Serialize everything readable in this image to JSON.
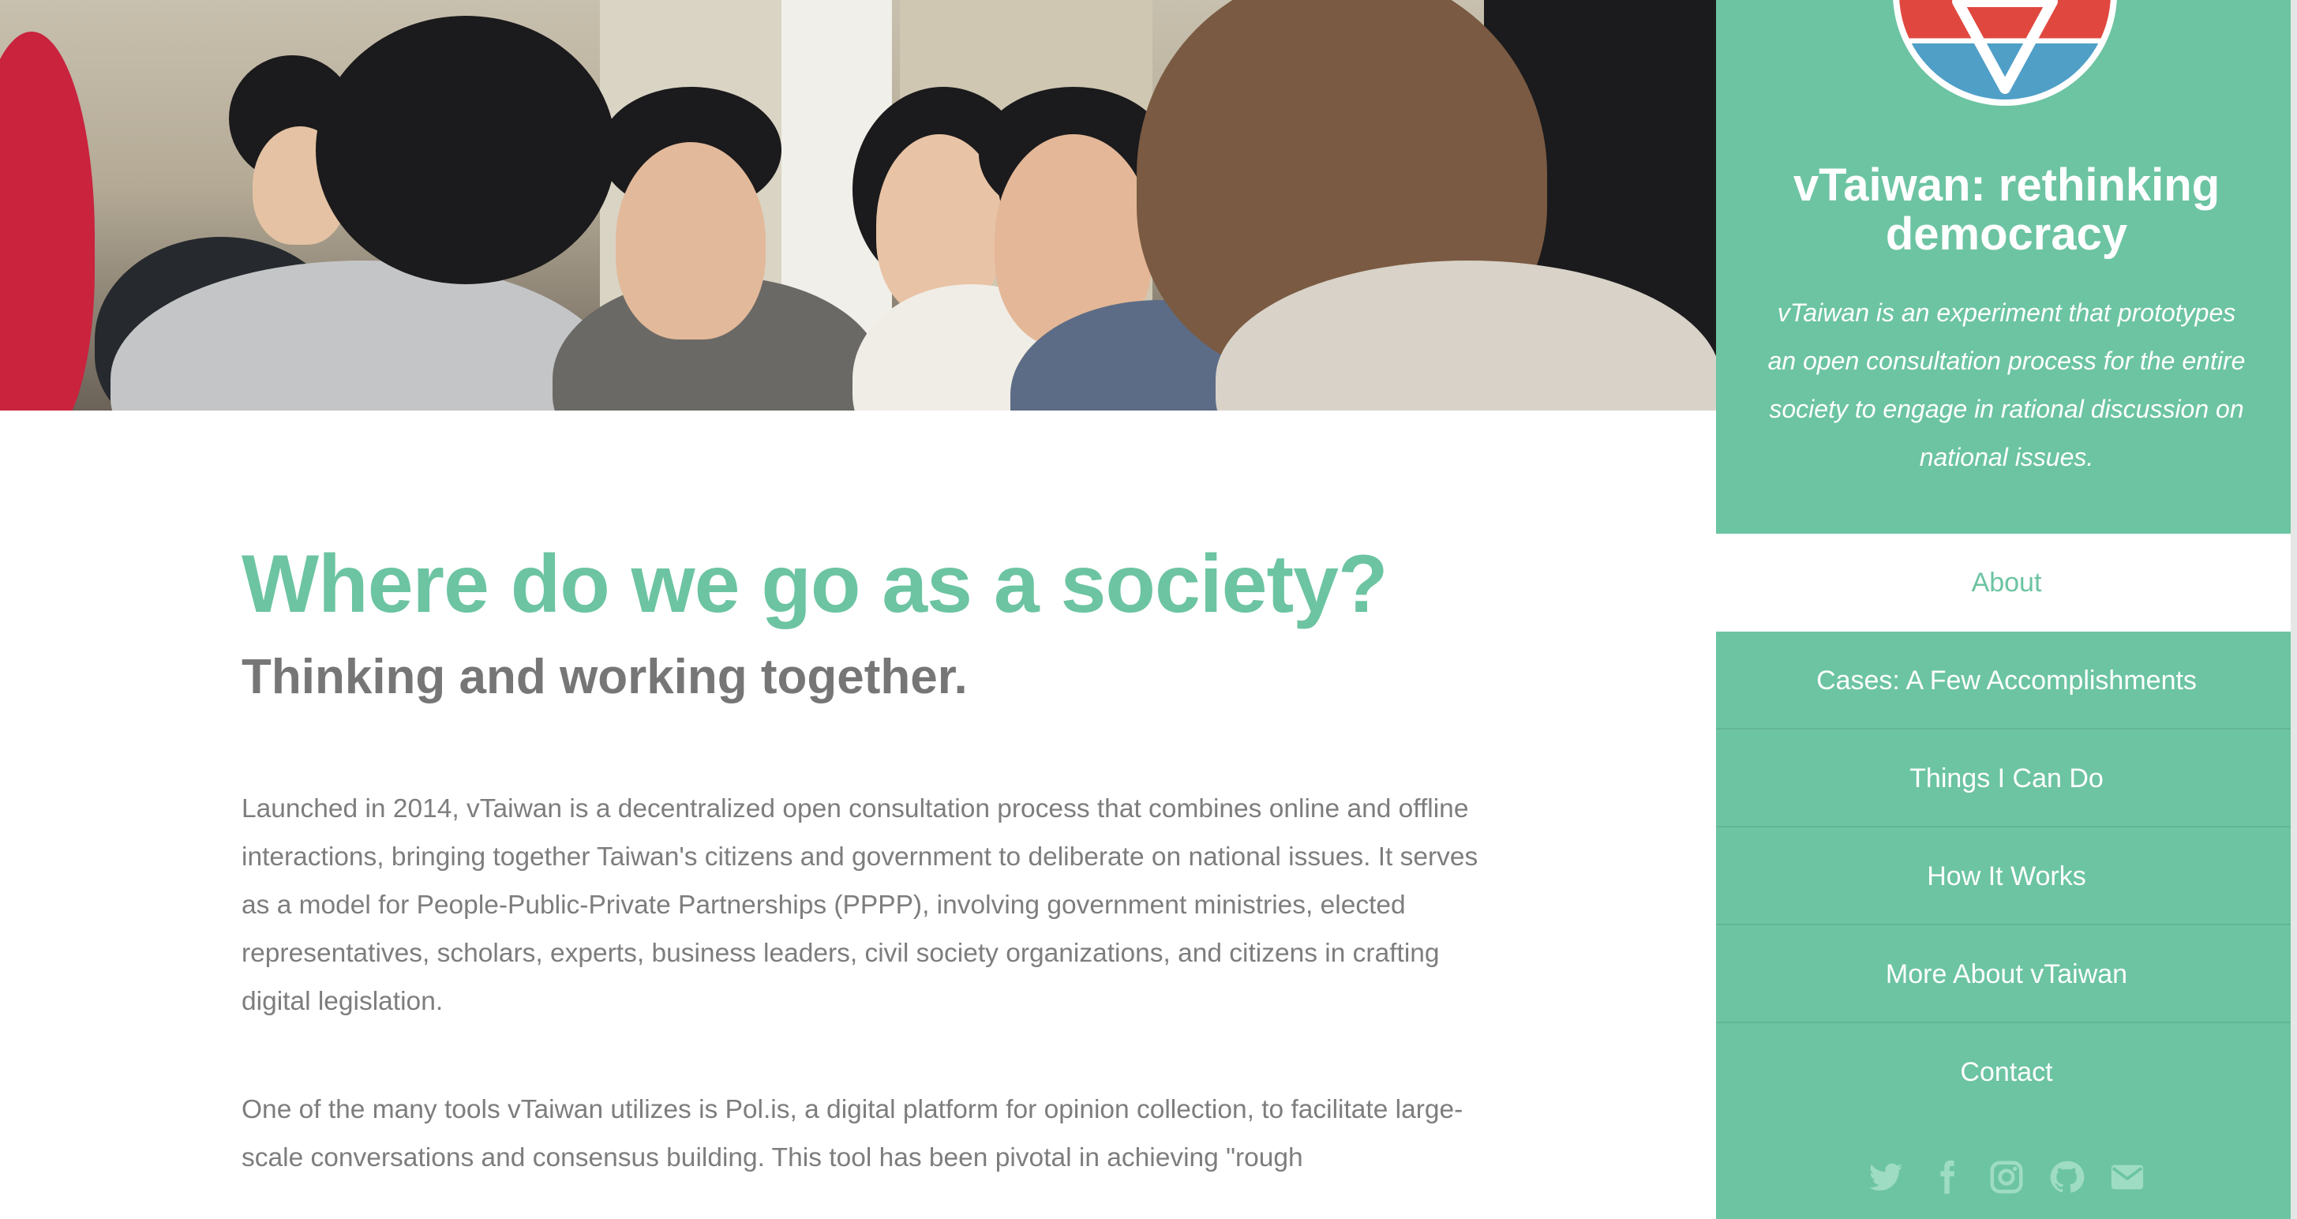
{
  "hero": {
    "image_description_icon": "photo-icon"
  },
  "main": {
    "headline": "Where do we go as a society?",
    "subheadline": "Thinking and working together.",
    "paragraphs": [
      "Launched in 2014, vTaiwan is a decentralized open consultation process that combines online and offline interactions, bringing together Taiwan's citizens and government to deliberate on national issues. It serves as a model for People-Public-Private Partnerships (PPPP), involving government ministries, elected representatives, scholars, experts, business leaders, civil society organizations, and citizens in crafting digital legislation.",
      "One of the many tools vTaiwan utilizes is Pol.is, a digital platform for opinion collection, to facilitate large-scale conversations and consensus building. This tool has been pivotal in achieving \"rough"
    ]
  },
  "sidebar": {
    "title": "vTaiwan: rethinking democracy",
    "description": "vTaiwan is an experiment that prototypes an open consultation process for the entire society to engage in rational discussion on national issues.",
    "nav": [
      {
        "label": "About",
        "active": true
      },
      {
        "label": "Cases: A Few Accomplishments",
        "active": false
      },
      {
        "label": "Things I Can Do",
        "active": false
      },
      {
        "label": "How It Works",
        "active": false
      },
      {
        "label": "More About vTaiwan",
        "active": false
      },
      {
        "label": "Contact",
        "active": false
      }
    ],
    "social": [
      "twitter-icon",
      "facebook-icon",
      "instagram-icon",
      "github-icon",
      "email-icon"
    ]
  },
  "colors": {
    "accent": "#6cc4a2",
    "subheadline": "#767676",
    "body_text": "#7d7d7d",
    "sidebar_text": "#ffffff"
  }
}
